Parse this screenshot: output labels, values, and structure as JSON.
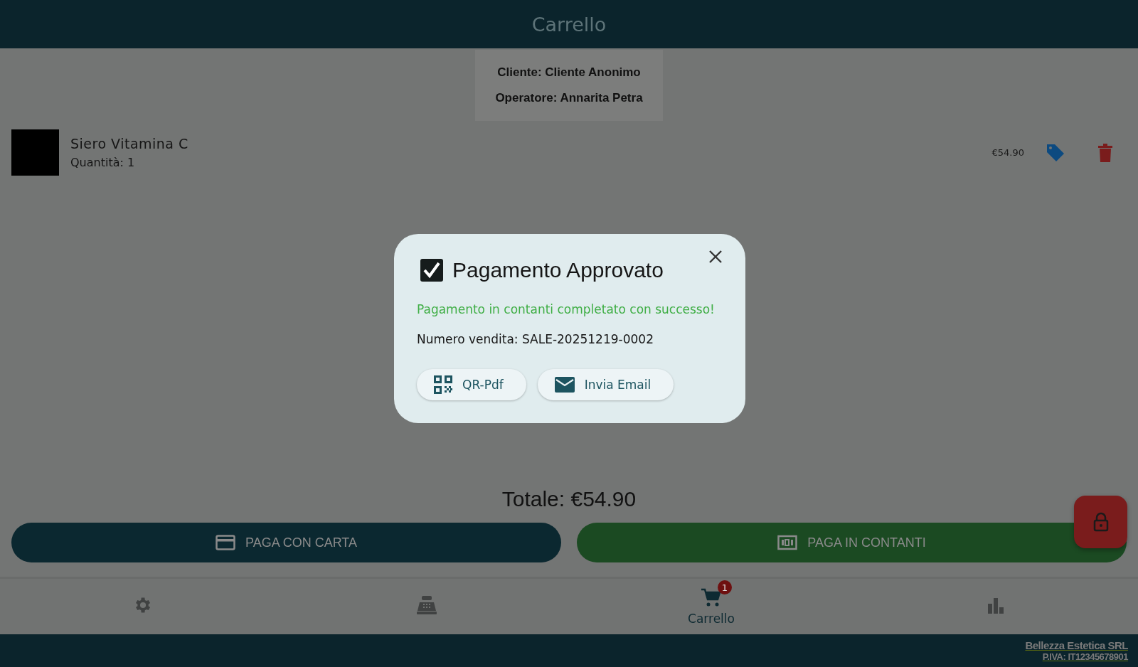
{
  "app_bar": {
    "title": "Carrello"
  },
  "session": {
    "customer": "Cliente: Cliente Anonimo",
    "operator": "Operatore: Annarita Petra"
  },
  "cart_items": [
    {
      "name": "Siero Vitamina C",
      "quantity": "Quantità: 1",
      "price": "€54.90"
    }
  ],
  "total": "Totale: €54.90",
  "pay_buttons": [
    {
      "kind": "card",
      "label": "PAGA CON CARTA"
    },
    {
      "kind": "cash",
      "label": "PAGA IN CONTANTI"
    }
  ],
  "bottom_nav": [
    {
      "kind": "settings",
      "selected": false
    },
    {
      "kind": "register",
      "selected": false
    },
    {
      "kind": "cart",
      "label": "Carrello",
      "badge": "1",
      "selected": true
    },
    {
      "kind": "stats",
      "selected": false
    }
  ],
  "footer": {
    "company": "Bellezza Estetica SRL",
    "vat": "P.IVA: IT12345678901"
  },
  "dialog": {
    "title": "Pagamento Approvato",
    "message": "Pagamento in contanti completato con successo!",
    "sale_number": "Numero vendita: SALE-20251219-0002",
    "actions": [
      {
        "kind": "qr",
        "label": "QR-Pdf"
      },
      {
        "kind": "email",
        "label": "Invia Email"
      }
    ]
  }
}
